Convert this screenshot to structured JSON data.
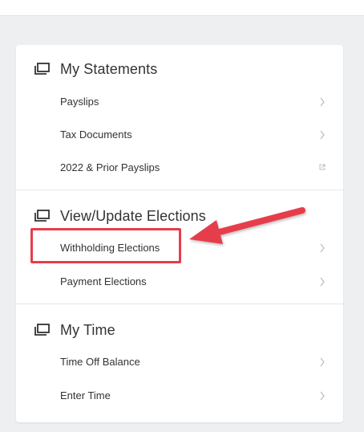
{
  "sections": [
    {
      "icon": "stacked-windows-icon",
      "title": "My Statements",
      "items": [
        {
          "label": "Payslips",
          "icon": "chevron-right-icon"
        },
        {
          "label": "Tax Documents",
          "icon": "chevron-right-icon"
        },
        {
          "label": "2022 & Prior Payslips",
          "icon": "external-link-icon"
        }
      ]
    },
    {
      "icon": "stacked-windows-icon",
      "title": "View/Update Elections",
      "items": [
        {
          "label": "Withholding Elections",
          "icon": "chevron-right-icon"
        },
        {
          "label": "Payment Elections",
          "icon": "chevron-right-icon"
        }
      ]
    },
    {
      "icon": "stacked-windows-icon",
      "title": "My Time",
      "items": [
        {
          "label": "Time Off Balance",
          "icon": "chevron-right-icon"
        },
        {
          "label": "Enter Time",
          "icon": "chevron-right-icon"
        }
      ]
    }
  ],
  "annotation": {
    "highlight_color": "#e63d4b",
    "target": "Withholding Elections"
  },
  "colors": {
    "background": "#eeeff1",
    "card": "#ffffff",
    "text": "#333333",
    "chevron": "#b8bbc0"
  }
}
